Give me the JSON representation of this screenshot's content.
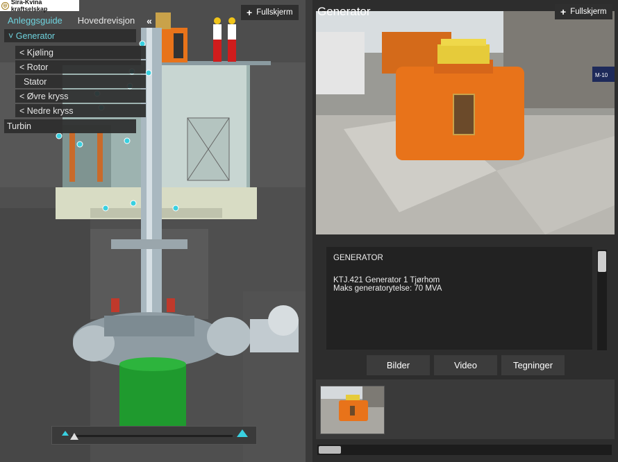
{
  "brand": {
    "name": "Sira-Kvina kraftselskap"
  },
  "topnav": {
    "guide": "Anleggsguide",
    "revision": "Hovedrevisjon",
    "collapse": "«"
  },
  "tree": {
    "generator": "˅ Generator",
    "kjoling": "< Kjøling",
    "rotor": "< Rotor",
    "stator": "Stator",
    "ovre": "< Øvre kryss",
    "nedre": "< Nedre kryss",
    "turbin": "Turbin"
  },
  "left_fullscreen": {
    "icon": "+",
    "label": "Fullskjerm"
  },
  "right_fullscreen": {
    "icon": "+",
    "label": "Fullskjerm"
  },
  "panel": {
    "title": "Generator",
    "info_heading": "GENERATOR",
    "info_line1": "KTJ.421 Generator 1 Tjørhom",
    "info_line2": "Maks generatorytelse: 70 MVA"
  },
  "tabs": {
    "images": "Bilder",
    "video": "Video",
    "drawings": "Tegninger"
  },
  "photo_sign": "M-10",
  "icons": {
    "brand": "logo-icon",
    "fullscreen": "plus-icon",
    "collapse": "double-chevron-left-icon"
  },
  "colors": {
    "accent": "#6fd3de",
    "generator_orange": "#e8731a",
    "turbine_green": "#1f9a2e"
  }
}
